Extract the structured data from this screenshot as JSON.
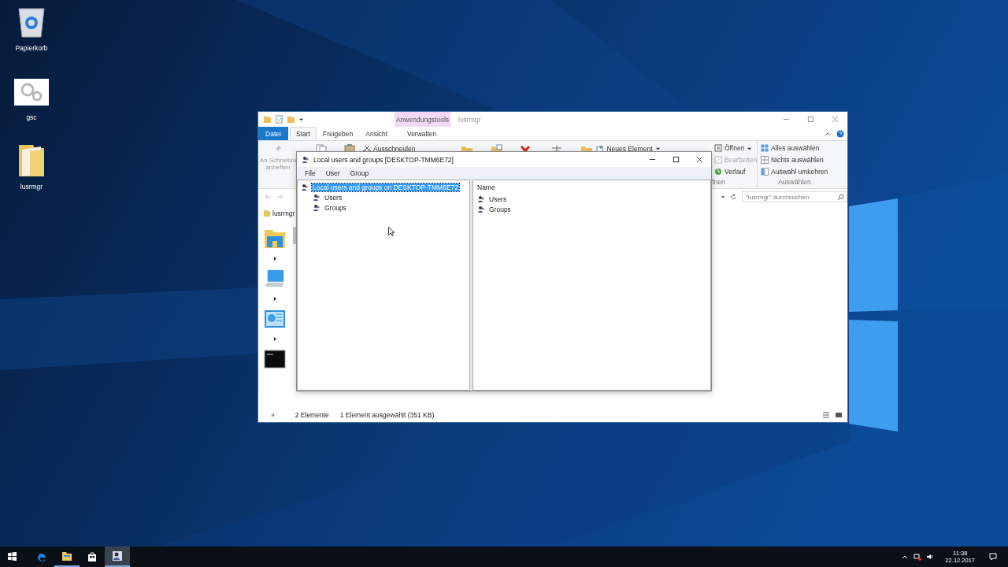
{
  "desktop_icons": [
    {
      "label": "Papierkorb",
      "kind": "recycle"
    },
    {
      "label": "gsc",
      "kind": "gears"
    },
    {
      "label": "lusrmgr",
      "kind": "folder"
    }
  ],
  "explorer": {
    "title": "lusrmgr",
    "context_tab": "Anwendungstools",
    "tabs": [
      {
        "label": "Datei",
        "kind": "file",
        "selected": false
      },
      {
        "label": "Start",
        "kind": "normal",
        "selected": true
      },
      {
        "label": "Freigeben",
        "kind": "normal",
        "selected": false
      },
      {
        "label": "Ansicht",
        "kind": "normal",
        "selected": false
      },
      {
        "label": "Verwalten",
        "kind": "context",
        "selected": false
      }
    ],
    "ribbon": {
      "pin_lines": [
        "An Schnellzu",
        "anheften"
      ],
      "cut": "Ausschneiden",
      "new_item": "Neues Element",
      "open_group": {
        "label": "ffnen",
        "items": [
          {
            "label": "Öffnen",
            "kind": "open",
            "disabled": false
          },
          {
            "label": "Bearbeiten",
            "kind": "edit",
            "disabled": true
          },
          {
            "label": "Verlauf",
            "kind": "history",
            "disabled": false
          }
        ]
      },
      "select_group": {
        "label": "Auswählen",
        "items": [
          {
            "label": "Alles auswählen",
            "kind": "all"
          },
          {
            "label": "Nichts auswählen",
            "kind": "none"
          },
          {
            "label": "Auswahl umkehren",
            "kind": "invert"
          }
        ]
      }
    },
    "search": {
      "placeholder": "\"lusrmgr\" durchsuchen"
    },
    "nav": {
      "items": [
        {
          "label": "lusrmgr"
        }
      ],
      "icons": [
        {
          "kind": "home"
        },
        {
          "kind": "pc"
        },
        {
          "kind": "panel"
        },
        {
          "kind": "console"
        }
      ]
    },
    "status": {
      "more": "»",
      "count": "2 Elemente",
      "selection": "1 Element ausgewählt (351 KB)"
    }
  },
  "dialog": {
    "title": "Local users and groups [DESKTOP-TMM6E72]",
    "menu": [
      "File",
      "User",
      "Group"
    ],
    "tree": {
      "label": "Local users and groups on DESKTOP-TMM6E72",
      "selected": true,
      "children": [
        {
          "label": "Users",
          "selected": false
        },
        {
          "label": "Groups",
          "selected": false
        }
      ]
    },
    "list": {
      "column": "Name",
      "rows": [
        {
          "label": "Users",
          "selected": false
        },
        {
          "label": "Groups",
          "selected": false
        }
      ]
    }
  },
  "taskbar": {
    "apps": [
      {
        "kind": "edge",
        "open": false,
        "active": false
      },
      {
        "kind": "explorer",
        "open": true,
        "active": false
      },
      {
        "kind": "store",
        "open": false,
        "active": false
      },
      {
        "kind": "lusrmgr",
        "open": true,
        "active": true
      }
    ],
    "time": "11:38",
    "date": "22.12.2017"
  }
}
